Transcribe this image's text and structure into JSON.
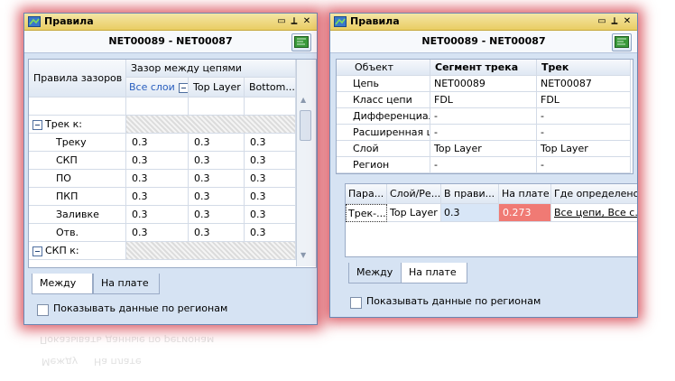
{
  "left": {
    "title": "Правила",
    "subtitle": "NET00089 - NET00087",
    "table": {
      "col_rules": "Правила зазоров",
      "col_group": "Зазор между цепями",
      "sub_all_layers": "Все слои",
      "sub_top_layer": "Top Layer",
      "sub_bottom": "Bottom...",
      "group_track": "Трек к:",
      "rows": [
        {
          "label": "Треку",
          "v1": "0.3",
          "v2": "0.3",
          "v3": "0.3"
        },
        {
          "label": "СКП",
          "v1": "0.3",
          "v2": "0.3",
          "v3": "0.3"
        },
        {
          "label": "ПО",
          "v1": "0.3",
          "v2": "0.3",
          "v3": "0.3"
        },
        {
          "label": "ПКП",
          "v1": "0.3",
          "v2": "0.3",
          "v3": "0.3"
        },
        {
          "label": "Заливке",
          "v1": "0.3",
          "v2": "0.3",
          "v3": "0.3"
        },
        {
          "label": "Отв.",
          "v1": "0.3",
          "v2": "0.3",
          "v3": "0.3"
        }
      ],
      "group_skp": "СКП к:"
    },
    "tabs": {
      "between": "Между",
      "on_board": "На плате"
    },
    "checkbox_label": "Показывать данные по регионам"
  },
  "right": {
    "title": "Правила",
    "subtitle": "NET00089 - NET00087",
    "props": {
      "head_object": "Объект",
      "head_segment": "Сегмент трека",
      "head_track": "Трек",
      "rows": [
        {
          "label": "Цепь",
          "a": "NET00089",
          "b": "NET00087"
        },
        {
          "label": "Класс цепи",
          "a": "FDL",
          "b": "FDL"
        },
        {
          "label": "Дифференциаль",
          "a": "-",
          "b": "-"
        },
        {
          "label": "Расширенная це",
          "a": "-",
          "b": "-"
        },
        {
          "label": "Слой",
          "a": "Top Layer",
          "b": "Top Layer"
        },
        {
          "label": "Регион",
          "a": "-",
          "b": "-"
        }
      ]
    },
    "rules": {
      "h_param": "Пара...",
      "h_layer": "Слой/Ре...",
      "h_inrule": "В прави...",
      "h_onboard": "На плате",
      "h_where": "Где определено",
      "row": {
        "param": "Трек-...",
        "layer": "Top Layer",
        "inrule": "0.3",
        "onboard": "0.273",
        "where": "Все цепи, Все с..."
      }
    },
    "tabs": {
      "between": "Между",
      "on_board": "На плате"
    },
    "checkbox_label": "Показывать данные по регионам"
  },
  "colors": {
    "highlight_red": "#f07a74",
    "highlight_blue": "#d8e6f7",
    "accent_blue": "#2b5fbf"
  }
}
